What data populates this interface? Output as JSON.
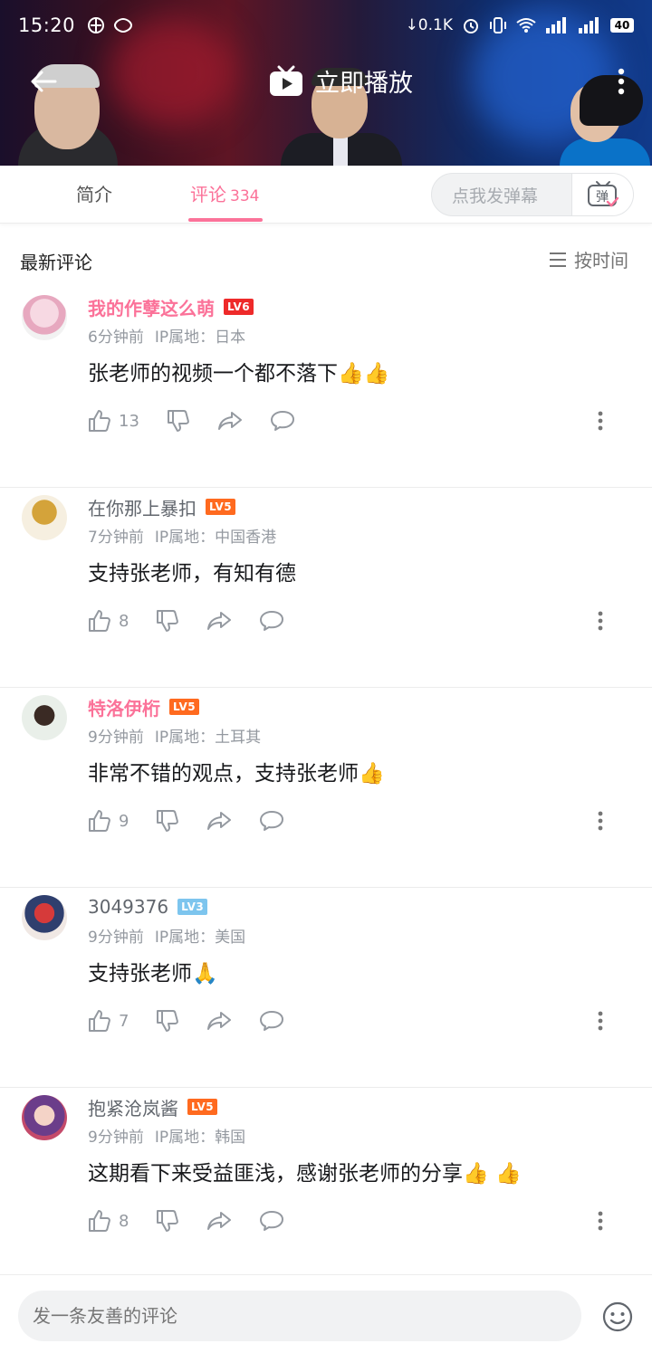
{
  "status_bar": {
    "time": "15:20",
    "net_speed": "↓0.1K",
    "battery": "40"
  },
  "player": {
    "play_now_label": "立即播放"
  },
  "tabs": {
    "intro_label": "简介",
    "comments_label": "评论",
    "comments_count": "334",
    "danmaku_placeholder": "点我发弹幕",
    "danmaku_toggle_label": "弹"
  },
  "list": {
    "title": "最新评论",
    "sort_label": "按时间"
  },
  "comments": [
    {
      "username": "我的作孽这么萌",
      "level": "LV6",
      "vip": true,
      "time": "6分钟前",
      "ip": "IP属地：日本",
      "content": "张老师的视频一个都不落下👍👍",
      "likes": "13"
    },
    {
      "username": "在你那上暴扣",
      "level": "LV5",
      "vip": false,
      "time": "7分钟前",
      "ip": "IP属地：中国香港",
      "content": "支持张老师，有知有德",
      "likes": "8"
    },
    {
      "username": "特洛伊桁",
      "level": "LV5",
      "vip": true,
      "time": "9分钟前",
      "ip": "IP属地：土耳其",
      "content": "非常不错的观点，支持张老师👍",
      "likes": "9"
    },
    {
      "username": "3049376",
      "level": "LV3",
      "vip": false,
      "time": "9分钟前",
      "ip": "IP属地：美国",
      "content": "支持张老师🙏",
      "likes": "7"
    },
    {
      "username": "抱紧沧岚酱",
      "level": "LV5",
      "vip": false,
      "time": "9分钟前",
      "ip": "IP属地：韩国",
      "content": "这期看下来受益匪浅，感谢张老师的分享👍 👍",
      "likes": "8"
    }
  ],
  "bottom": {
    "input_placeholder": "发一条友善的评论"
  },
  "colors": {
    "accent_pink": "#fb7299",
    "lv6": "#ee2a2a",
    "lv5": "#ff6a1f",
    "lv3": "#7dc5ee"
  }
}
